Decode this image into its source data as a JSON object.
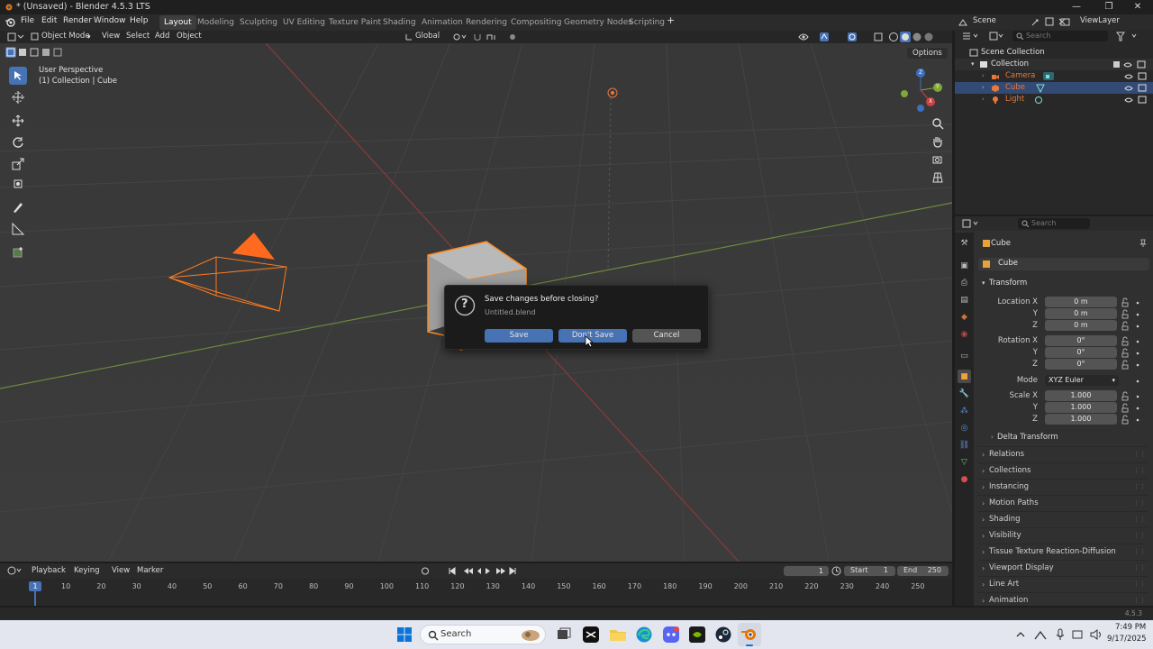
{
  "window": {
    "title": "* (Unsaved) - Blender 4.5.3 LTS",
    "controls": [
      "—",
      "❐",
      "✕"
    ]
  },
  "menu": [
    "File",
    "Edit",
    "Render",
    "Window",
    "Help"
  ],
  "workspaces": [
    "Layout",
    "Modeling",
    "Sculpting",
    "UV Editing",
    "Texture Paint",
    "Shading",
    "Animation",
    "Rendering",
    "Compositing",
    "Geometry Nodes",
    "Scripting"
  ],
  "active_workspace": "Layout",
  "add_workspace": "+",
  "scene": {
    "label": "Scene",
    "view_layer": "ViewLayer"
  },
  "viewport_header": {
    "mode": "Object Mode",
    "menus": [
      "View",
      "Select",
      "Add",
      "Object"
    ],
    "orientation": "Global",
    "options": "Options"
  },
  "viewport": {
    "perspective": "User Perspective",
    "context": "(1) Collection | Cube",
    "gizmo": {
      "x": "X",
      "y": "Y",
      "z": "Z"
    }
  },
  "dialog": {
    "question_icon": "?",
    "title": "Save changes before closing?",
    "filename": "Untitled.blend",
    "save": "Save",
    "dont_save": "Don't Save",
    "cancel": "Cancel"
  },
  "outliner": {
    "search_placeholder": "Search",
    "root": "Scene Collection",
    "collection": "Collection",
    "items": [
      {
        "name": "Camera",
        "icon": "camera-icon",
        "color": "#e8773a"
      },
      {
        "name": "Cube",
        "icon": "mesh-icon",
        "color": "#e8773a"
      },
      {
        "name": "Light",
        "icon": "light-icon",
        "color": "#e8773a"
      }
    ]
  },
  "properties": {
    "search_placeholder": "Search",
    "object_name": "Cube",
    "data_name": "Cube",
    "transform_label": "Transform",
    "location_label": "Location X",
    "rotation_label": "Rotation X",
    "scale_label": "Scale X",
    "axis_y": "Y",
    "axis_z": "Z",
    "location": [
      "0 m",
      "0 m",
      "0 m"
    ],
    "rotation": [
      "0°",
      "0°",
      "0°"
    ],
    "mode_label": "Mode",
    "mode_value": "XYZ Euler",
    "scale": [
      "1.000",
      "1.000",
      "1.000"
    ],
    "delta": "Delta Transform",
    "panels": [
      "Relations",
      "Collections",
      "Instancing",
      "Motion Paths",
      "Shading",
      "Visibility",
      "Tissue Texture Reaction-Diffusion",
      "Viewport Display",
      "Line Art",
      "Animation"
    ]
  },
  "timeline": {
    "menus": [
      "Playback",
      "Keying",
      "View",
      "Marker"
    ],
    "current_frame": "1",
    "start_label": "Start",
    "start": "1",
    "end_label": "End",
    "end": "250",
    "ruler": [
      "10",
      "20",
      "30",
      "40",
      "50",
      "60",
      "70",
      "80",
      "90",
      "100",
      "110",
      "120",
      "130",
      "140",
      "150",
      "160",
      "170",
      "180",
      "190",
      "200",
      "210",
      "220",
      "230",
      "240",
      "250"
    ]
  },
  "status": {
    "version": "4.5.3"
  },
  "taskbar": {
    "search": "Search",
    "time": "7:49 PM",
    "date": "9/17/2025"
  },
  "colors": {
    "accent": "#4772b3",
    "selection_orange": "#ff8a1f",
    "panel": "#303030",
    "viewport_bg": "#393939"
  }
}
